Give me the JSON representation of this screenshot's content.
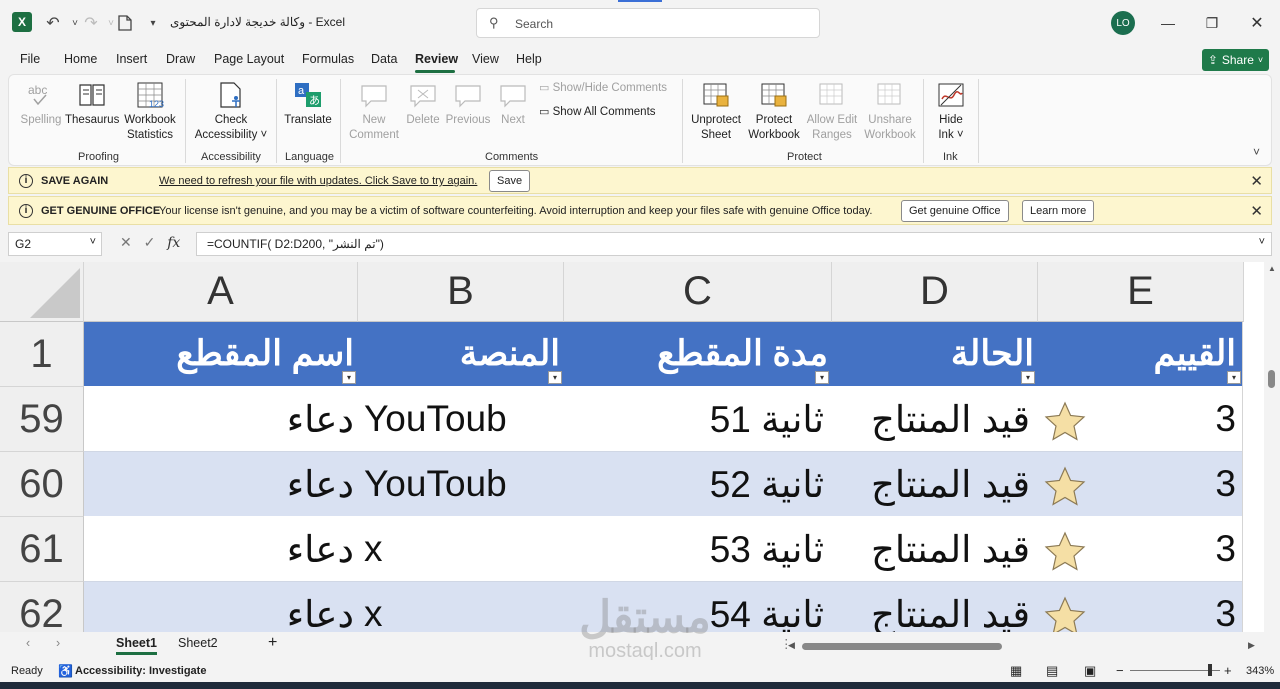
{
  "titlebar": {
    "doc_title": "وكالة خديجة لادارة المحتوى  -  Excel",
    "search_placeholder": "Search",
    "avatar_initials": "LO"
  },
  "menu": [
    "File",
    "Home",
    "Insert",
    "Draw",
    "Page Layout",
    "Formulas",
    "Data",
    "Review",
    "View",
    "Help"
  ],
  "share_label": "Share",
  "ribbon": {
    "spelling": "Spelling",
    "thesaurus": "Thesaurus",
    "workbook_statistics_1": "Workbook",
    "workbook_statistics_2": "Statistics",
    "proofing": "Proofing",
    "check_access_1": "Check",
    "check_access_2": "Accessibility ˅",
    "accessibility": "Accessibility",
    "translate": "Translate",
    "language": "Language",
    "new_comment_1": "New",
    "new_comment_2": "Comment",
    "delete": "Delete",
    "previous": "Previous",
    "next": "Next",
    "show_hide_comments": "Show/Hide Comments",
    "show_all_comments": "Show All Comments",
    "comments": "Comments",
    "unprotect_sheet_1": "Unprotect",
    "unprotect_sheet_2": "Sheet",
    "protect_workbook_1": "Protect",
    "protect_workbook_2": "Workbook",
    "allow_edit_1": "Allow Edit",
    "allow_edit_2": "Ranges",
    "unshare_1": "Unshare",
    "unshare_2": "Workbook",
    "protect": "Protect",
    "hide_ink_1": "Hide",
    "hide_ink_2": "Ink ˅",
    "ink": "Ink"
  },
  "notif_save": {
    "title": "SAVE AGAIN",
    "message": "We need to refresh your file with updates. Click Save to try again.",
    "button": "Save"
  },
  "notif_genuine": {
    "title": "GET GENUINE OFFICE",
    "message": "Your license isn't genuine, and you may be a victim of software counterfeiting. Avoid interruption and keep your files safe with genuine Office today.",
    "button1": "Get genuine Office",
    "button2": "Learn more"
  },
  "formula_bar": {
    "name_box": "G2",
    "formula": "=COUNTIF( D2:D200, \"تم النشر\")"
  },
  "grid": {
    "columns": [
      "A",
      "B",
      "C",
      "D",
      "E"
    ],
    "header_row_number": "1",
    "header_cells": [
      "اسم المقطع",
      "المنصة",
      "مدة المقطع",
      "الحالة",
      "القييم"
    ],
    "rows": [
      {
        "num": "59",
        "a": "دعاء",
        "b": "YouToub",
        "c": "ثانية 51",
        "d": "قيد المنتاج",
        "e": "3"
      },
      {
        "num": "60",
        "a": "دعاء",
        "b": "YouToub",
        "c": "ثانية 52",
        "d": "قيد المنتاج",
        "e": "3"
      },
      {
        "num": "61",
        "a": "دعاء",
        "b": "x",
        "c": "ثانية 53",
        "d": "قيد المنتاج",
        "e": "3"
      },
      {
        "num": "62",
        "a": "دعاء",
        "b": "x",
        "c": "ثانية 54",
        "d": "قيد المنتاج",
        "e": "3"
      }
    ],
    "header_color": "#4472c4",
    "band_color": "#d9e1f2"
  },
  "tabs": {
    "sheet1": "Sheet1",
    "sheet2": "Sheet2"
  },
  "status": {
    "ready": "Ready",
    "accessibility": "Accessibility: Investigate",
    "zoom": "343%"
  },
  "watermark": {
    "main": "مستقل",
    "sub": "mostaql.com"
  }
}
